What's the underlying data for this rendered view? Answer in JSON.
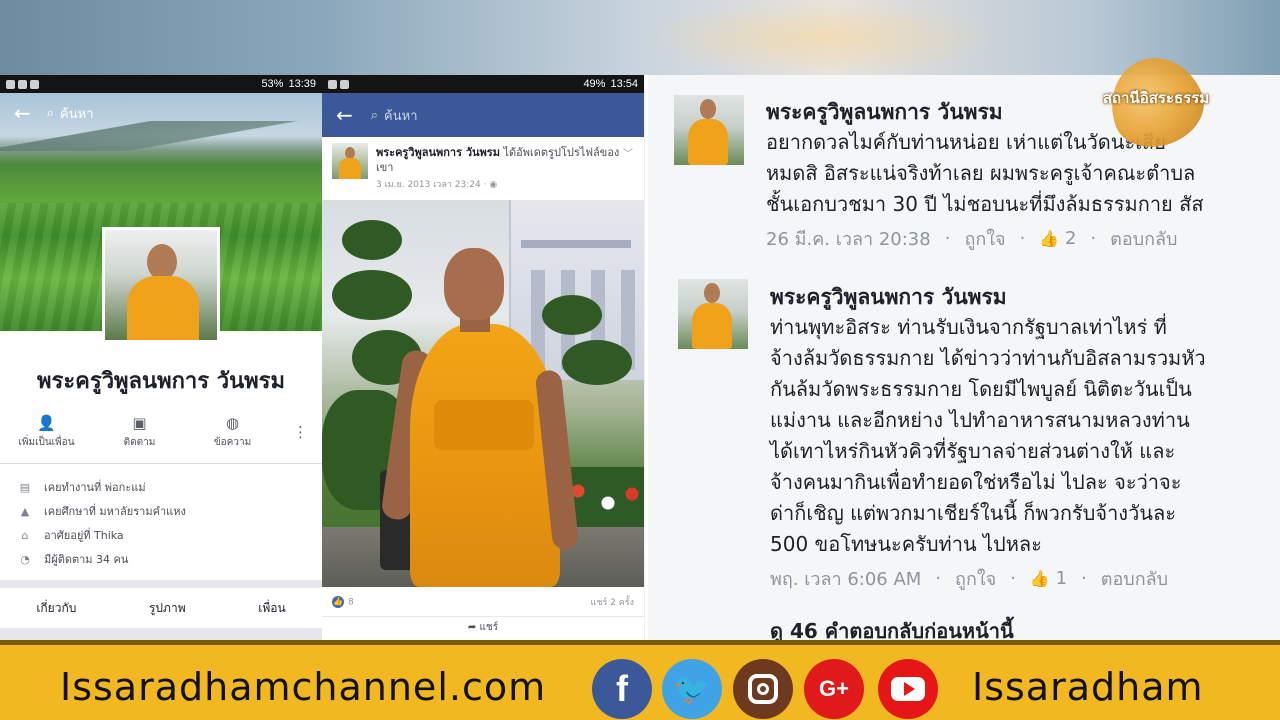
{
  "panel1": {
    "status": {
      "battery": "53%",
      "time": "13:39"
    },
    "search_placeholder": "ค้นหา",
    "profile_name": "พระครูวิพูลนพการ วันพรม",
    "actions": [
      {
        "label": "เพิ่มเป็นเพื่อน",
        "icon": "add-friend-icon"
      },
      {
        "label": "ติดตาม",
        "icon": "follow-icon"
      },
      {
        "label": "ข้อความ",
        "icon": "messenger-icon"
      }
    ],
    "info": [
      {
        "text": "เคยทำงานที่ พ่อกะแม่",
        "icon": "briefcase-icon"
      },
      {
        "text": "เคยศึกษาที่ มหาลัยรามคำแหง",
        "icon": "graduation-cap-icon"
      },
      {
        "text": "อาศัยอยู่ที่ Thika",
        "icon": "home-icon"
      },
      {
        "text": "มีผู้ติดตาม 34 คน",
        "icon": "rss-icon"
      }
    ],
    "tabs": [
      "เกี่ยวกับ",
      "รูปภาพ",
      "เพื่อน"
    ]
  },
  "panel2": {
    "status": {
      "battery": "49%",
      "time": "13:54"
    },
    "search_placeholder": "ค้นหา",
    "post_author": "พระครูวิพูลนพการ วันพรม",
    "post_action": "ได้อัพเดตรูปโปรไฟล์ของเขา",
    "post_time": "3 เม.ย. 2013 เวลา 23:24",
    "likes": "8",
    "shares": "แชร์ 2 ครั้ง",
    "share_label": "แชร์"
  },
  "panel3": {
    "comments": [
      {
        "name": "พระครูวิพูลนพการ วันพรม",
        "text": "อยากดวลไมค์กับท่านหน่อย เห่าแต่ในวัดนะเสีย\nหมดสิ อิสระแน่จริงท้าเลย ผมพระครูเจ้าคณะตำบล\nชั้นเอกบวชมา 30 ปี ไม่ชอบนะที่มึงล้มธรรมกาย สัส",
        "time": "26 มี.ค. เวลา 20:38",
        "like_label": "ถูกใจ",
        "like_count": "2",
        "reply_label": "ตอบกลับ"
      },
      {
        "name": "พระครูวิพูลนพการ วันพรม",
        "text": "ท่านพุทะอิสระ ท่านรับเงินจากรัฐบาลเท่าไหร่ ที่\nจ้างล้มวัดธรรมกาย ได้ข่าวว่าท่านกับอิสลามรวมหัว\nกันล้มวัดพระธรรมกาย โดยมีไพบูลย์ นิติตะวันเป็น\nแม่งาน  และอีกหย่าง ไปทำอาหารสนามหลวงท่าน\nได้เทาไหร่กินหัวคิวที่รัฐบาลจ่ายส่วนต่างให้ และ\nจ้างคนมากินเพื่อทำยอดใช่หรือไม่   ไปละ จะว่าจะ\nด่าก็เชิญ แต่พวกมาเชียร์ในนี้ ก็พวกรับจ้างวันละ\n500  ขอโทษนะครับท่าน ไปหละ",
        "time": "พฤ. เวลา 6:06 AM",
        "like_label": "ถูกใจ",
        "like_count": "1",
        "reply_label": "ตอบกลับ"
      }
    ],
    "more_replies": "ดู 46 คำตอบกลับก่อนหน้านี้"
  },
  "logo": {
    "text": "สถานีอิสระธรรม"
  },
  "footer": {
    "website": "Issaradhamchannel.com",
    "handle": "Issaradham",
    "social_icons": [
      "facebook-icon",
      "twitter-icon",
      "instagram-icon",
      "google-plus-icon",
      "youtube-icon"
    ]
  },
  "colors": {
    "facebook_blue": "#3b5998",
    "footer_gold": "#f2b821",
    "robe_orange": "#f0a21a"
  }
}
